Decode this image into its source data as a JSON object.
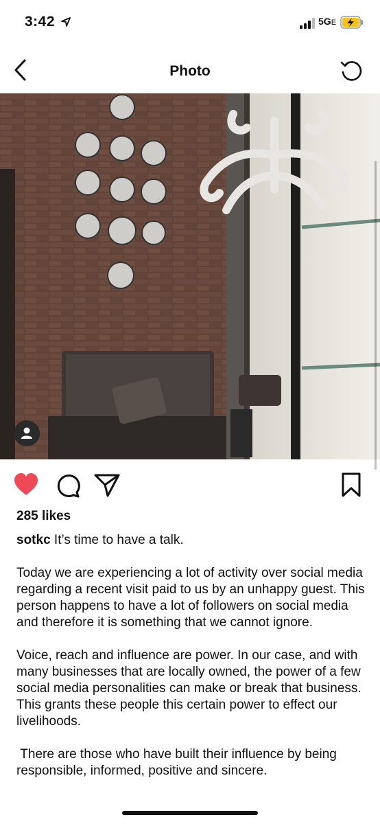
{
  "status": {
    "time": "3:42",
    "network": "5G",
    "network_suffix": "E"
  },
  "nav": {
    "title": "Photo"
  },
  "post": {
    "likes": "285 likes",
    "username": "sotkc",
    "caption_first": " It’s time to have a talk.",
    "paragraphs": [
      "Today we are experiencing a lot of activity over social media regarding a recent visit paid to us by an unhappy guest. This person happens to have a lot of followers on social media and therefore it is something that we cannot ignore.",
      "Voice, reach and influence are power. In our case, and with many businesses that are locally owned, the power of a few social media personalities can make or break that business. This grants these people this certain power to effect our livelihoods.",
      " There are those who have built their influence by being responsible, informed, positive and sincere."
    ]
  },
  "colors": {
    "like": "#ed4956",
    "text": "#111111"
  },
  "icons": [
    "location-arrow-icon",
    "signal-icon",
    "battery-charging-icon",
    "back-chevron-icon",
    "refresh-icon",
    "heart-icon",
    "comment-icon",
    "share-icon",
    "bookmark-icon",
    "user-tag-icon"
  ]
}
